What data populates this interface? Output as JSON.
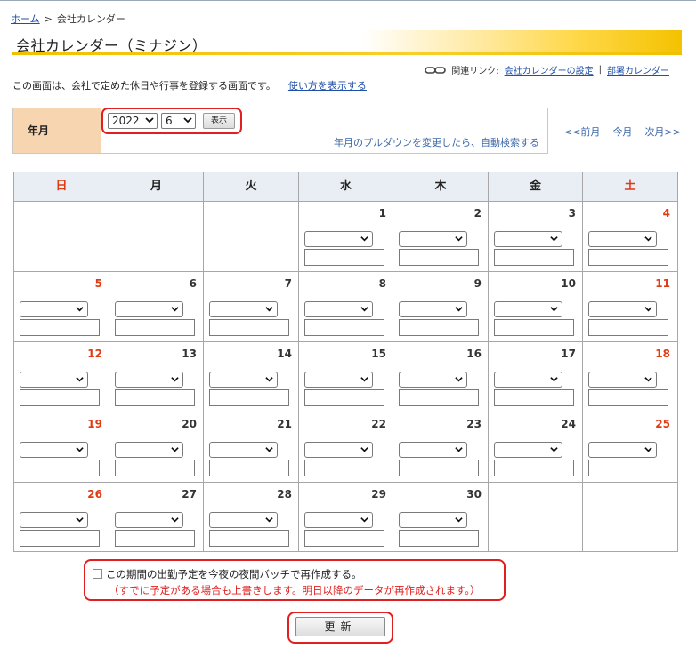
{
  "breadcrumb": {
    "home": "ホーム",
    "separator": ">",
    "current": "会社カレンダー"
  },
  "page_title": "会社カレンダー（ミナジン）",
  "related_links": {
    "label": "関連リンク:",
    "link1": "会社カレンダーの設定",
    "divider": "|",
    "link2": "部署カレンダー"
  },
  "intro": {
    "text": "この画面は、会社で定めた休日や行事を登録する画面です。",
    "help_link": "使い方を表示する"
  },
  "ym": {
    "label": "年月",
    "year": "2022",
    "month": "6",
    "show_button": "表示",
    "note": "年月のプルダウンを変更したら、自動検索する"
  },
  "month_nav": {
    "prev": "<<前月",
    "current": "今月",
    "next": "次月>>"
  },
  "weekdays": [
    "日",
    "月",
    "火",
    "水",
    "木",
    "金",
    "土"
  ],
  "days": [
    "1",
    "2",
    "3",
    "4",
    "5",
    "6",
    "7",
    "8",
    "9",
    "10",
    "11",
    "12",
    "13",
    "14",
    "15",
    "16",
    "17",
    "18",
    "19",
    "20",
    "21",
    "22",
    "23",
    "24",
    "25",
    "26",
    "27",
    "28",
    "29",
    "30"
  ],
  "colors": {
    "weekend": "#e03a14",
    "header_bg": "#e8eef3",
    "label_bg": "#f7d5b0",
    "highlight": "#e02020",
    "link": "#1f4fa8"
  },
  "regen": {
    "checkbox_label": "この期間の出勤予定を今夜の夜間バッチで再作成する。",
    "warning": "（すでに予定がある場合も上書きします。明日以降のデータが再作成されます。）",
    "checked": false
  },
  "update_button": "更新"
}
